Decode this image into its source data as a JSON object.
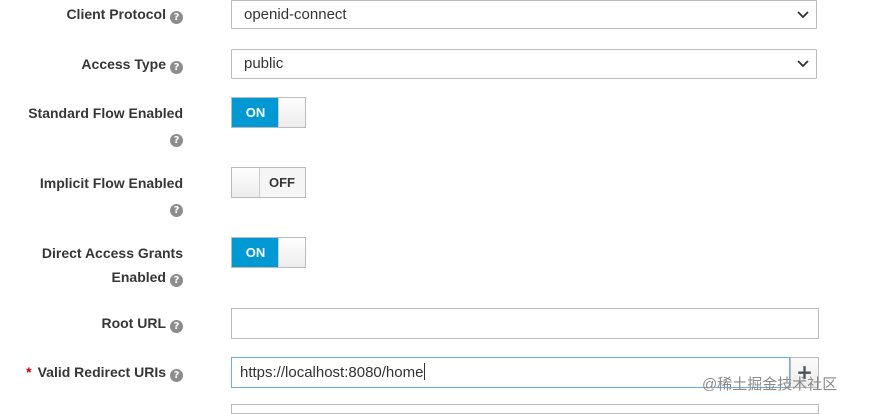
{
  "client_protocol": {
    "label": "Client Protocol",
    "value": "openid-connect"
  },
  "access_type": {
    "label": "Access Type",
    "value": "public"
  },
  "standard_flow": {
    "label": "Standard Flow Enabled",
    "state": "ON"
  },
  "implicit_flow": {
    "label": "Implicit Flow Enabled",
    "state": "OFF"
  },
  "direct_access": {
    "label_line1": "Direct Access Grants",
    "label_line2": "Enabled",
    "state": "ON"
  },
  "root_url": {
    "label": "Root URL",
    "value": ""
  },
  "valid_redirect": {
    "required_mark": "*",
    "label": "Valid Redirect URIs",
    "value": "https://localhost:8080/home",
    "add_label": "+"
  },
  "help_glyph": "?",
  "watermark": "@稀土掘金技术社区",
  "colors": {
    "accent": "#0099d3",
    "required": "#cc0000"
  }
}
